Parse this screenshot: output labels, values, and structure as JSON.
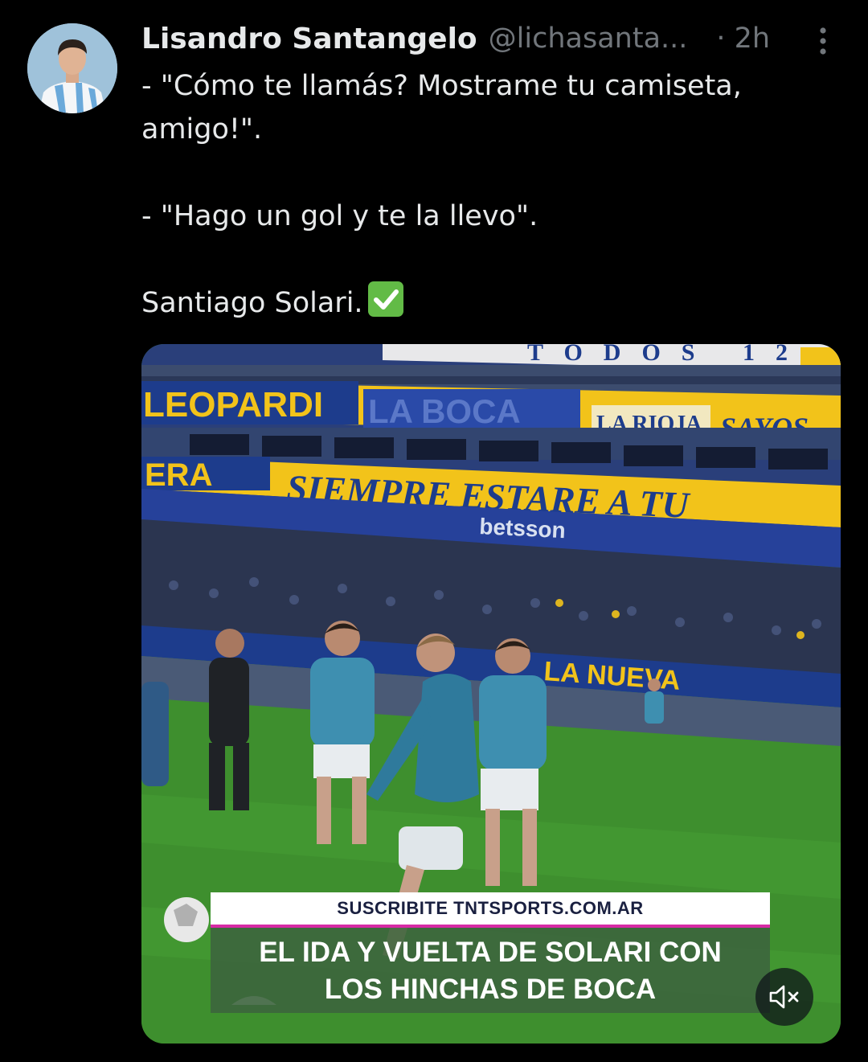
{
  "tweet": {
    "author_name": "Lisandro Santangelo",
    "author_handle": "@lichasanta...",
    "time": "· 2h",
    "text_lines": [
      "- \"Cómo te llamás? Mostrame tu camiseta,",
      "amigo!\".",
      "- \"Hago un gol y te la llevo\".",
      "Santiago Solari."
    ],
    "emoji": "check-mark-button-icon"
  },
  "media": {
    "caption_top": "SUSCRIBITE TNTSPORTS.COM.AR",
    "caption_line1": "EL IDA Y VUELTA DE SOLARI CON",
    "caption_line2": "LOS HINCHAS DE BOCA",
    "mute_icon": "volume-muted-icon",
    "stadium_banners": {
      "top": "TODOS 12",
      "left": "LEOPARDI",
      "center": "LA BOCA",
      "rioja": "LA RIOJA",
      "right": "SAYOS",
      "siempre": "SIEMPRE ESTARE A TU",
      "era": "ERA",
      "sponsor": "betsson",
      "nueva": "LA NUEVA"
    }
  },
  "colors": {
    "background": "#000000",
    "text_primary": "#e7e9ea",
    "text_secondary": "#71767b",
    "boca_blue": "#1d3c8c",
    "boca_yellow": "#f2c31a",
    "caption_accent": "#d72aa5"
  }
}
